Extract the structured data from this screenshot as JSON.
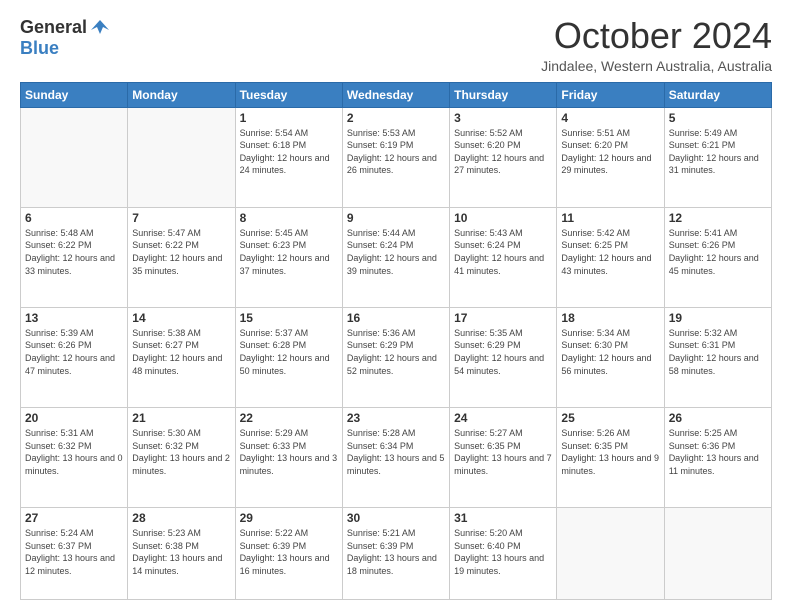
{
  "logo": {
    "general": "General",
    "blue": "Blue"
  },
  "header": {
    "month": "October 2024",
    "location": "Jindalee, Western Australia, Australia"
  },
  "weekdays": [
    "Sunday",
    "Monday",
    "Tuesday",
    "Wednesday",
    "Thursday",
    "Friday",
    "Saturday"
  ],
  "weeks": [
    [
      {
        "day": "",
        "info": ""
      },
      {
        "day": "",
        "info": ""
      },
      {
        "day": "1",
        "info": "Sunrise: 5:54 AM\nSunset: 6:18 PM\nDaylight: 12 hours and 24 minutes."
      },
      {
        "day": "2",
        "info": "Sunrise: 5:53 AM\nSunset: 6:19 PM\nDaylight: 12 hours and 26 minutes."
      },
      {
        "day": "3",
        "info": "Sunrise: 5:52 AM\nSunset: 6:20 PM\nDaylight: 12 hours and 27 minutes."
      },
      {
        "day": "4",
        "info": "Sunrise: 5:51 AM\nSunset: 6:20 PM\nDaylight: 12 hours and 29 minutes."
      },
      {
        "day": "5",
        "info": "Sunrise: 5:49 AM\nSunset: 6:21 PM\nDaylight: 12 hours and 31 minutes."
      }
    ],
    [
      {
        "day": "6",
        "info": "Sunrise: 5:48 AM\nSunset: 6:22 PM\nDaylight: 12 hours and 33 minutes."
      },
      {
        "day": "7",
        "info": "Sunrise: 5:47 AM\nSunset: 6:22 PM\nDaylight: 12 hours and 35 minutes."
      },
      {
        "day": "8",
        "info": "Sunrise: 5:45 AM\nSunset: 6:23 PM\nDaylight: 12 hours and 37 minutes."
      },
      {
        "day": "9",
        "info": "Sunrise: 5:44 AM\nSunset: 6:24 PM\nDaylight: 12 hours and 39 minutes."
      },
      {
        "day": "10",
        "info": "Sunrise: 5:43 AM\nSunset: 6:24 PM\nDaylight: 12 hours and 41 minutes."
      },
      {
        "day": "11",
        "info": "Sunrise: 5:42 AM\nSunset: 6:25 PM\nDaylight: 12 hours and 43 minutes."
      },
      {
        "day": "12",
        "info": "Sunrise: 5:41 AM\nSunset: 6:26 PM\nDaylight: 12 hours and 45 minutes."
      }
    ],
    [
      {
        "day": "13",
        "info": "Sunrise: 5:39 AM\nSunset: 6:26 PM\nDaylight: 12 hours and 47 minutes."
      },
      {
        "day": "14",
        "info": "Sunrise: 5:38 AM\nSunset: 6:27 PM\nDaylight: 12 hours and 48 minutes."
      },
      {
        "day": "15",
        "info": "Sunrise: 5:37 AM\nSunset: 6:28 PM\nDaylight: 12 hours and 50 minutes."
      },
      {
        "day": "16",
        "info": "Sunrise: 5:36 AM\nSunset: 6:29 PM\nDaylight: 12 hours and 52 minutes."
      },
      {
        "day": "17",
        "info": "Sunrise: 5:35 AM\nSunset: 6:29 PM\nDaylight: 12 hours and 54 minutes."
      },
      {
        "day": "18",
        "info": "Sunrise: 5:34 AM\nSunset: 6:30 PM\nDaylight: 12 hours and 56 minutes."
      },
      {
        "day": "19",
        "info": "Sunrise: 5:32 AM\nSunset: 6:31 PM\nDaylight: 12 hours and 58 minutes."
      }
    ],
    [
      {
        "day": "20",
        "info": "Sunrise: 5:31 AM\nSunset: 6:32 PM\nDaylight: 13 hours and 0 minutes."
      },
      {
        "day": "21",
        "info": "Sunrise: 5:30 AM\nSunset: 6:32 PM\nDaylight: 13 hours and 2 minutes."
      },
      {
        "day": "22",
        "info": "Sunrise: 5:29 AM\nSunset: 6:33 PM\nDaylight: 13 hours and 3 minutes."
      },
      {
        "day": "23",
        "info": "Sunrise: 5:28 AM\nSunset: 6:34 PM\nDaylight: 13 hours and 5 minutes."
      },
      {
        "day": "24",
        "info": "Sunrise: 5:27 AM\nSunset: 6:35 PM\nDaylight: 13 hours and 7 minutes."
      },
      {
        "day": "25",
        "info": "Sunrise: 5:26 AM\nSunset: 6:35 PM\nDaylight: 13 hours and 9 minutes."
      },
      {
        "day": "26",
        "info": "Sunrise: 5:25 AM\nSunset: 6:36 PM\nDaylight: 13 hours and 11 minutes."
      }
    ],
    [
      {
        "day": "27",
        "info": "Sunrise: 5:24 AM\nSunset: 6:37 PM\nDaylight: 13 hours and 12 minutes."
      },
      {
        "day": "28",
        "info": "Sunrise: 5:23 AM\nSunset: 6:38 PM\nDaylight: 13 hours and 14 minutes."
      },
      {
        "day": "29",
        "info": "Sunrise: 5:22 AM\nSunset: 6:39 PM\nDaylight: 13 hours and 16 minutes."
      },
      {
        "day": "30",
        "info": "Sunrise: 5:21 AM\nSunset: 6:39 PM\nDaylight: 13 hours and 18 minutes."
      },
      {
        "day": "31",
        "info": "Sunrise: 5:20 AM\nSunset: 6:40 PM\nDaylight: 13 hours and 19 minutes."
      },
      {
        "day": "",
        "info": ""
      },
      {
        "day": "",
        "info": ""
      }
    ]
  ]
}
